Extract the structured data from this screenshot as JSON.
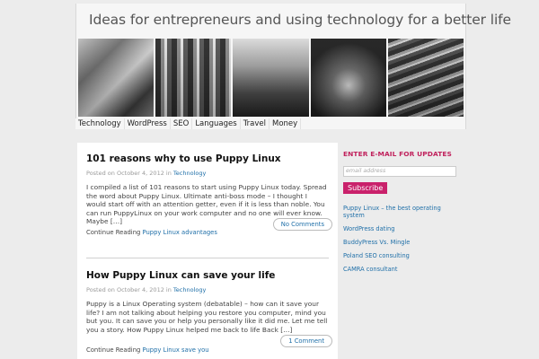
{
  "site": {
    "title": "Ideas for entrepreneurs and using technology for a better life"
  },
  "nav": [
    "Technology",
    "WordPress",
    "SEO",
    "Languages",
    "Travel",
    "Money"
  ],
  "posts": [
    {
      "title": "101 reasons why to use Puppy Linux",
      "meta_prefix": "Posted on October 4, 2012 in",
      "category": "Technology",
      "excerpt": "I compiled a list of 101 reasons to start using Puppy Linux today. Spread the word about Puppy Linux. Ultimate anti-boss mode – I thought I would start off with an attention getter, even if it is less than noble. You can run PuppyLinux on your work computer and no one will ever know. Maybe […]",
      "comments": "No Comments",
      "continue_prefix": "Continue Reading",
      "continue_link": "Puppy Linux advantages"
    },
    {
      "title": "How Puppy Linux can save your life",
      "meta_prefix": "Posted on October 4, 2012 in",
      "category": "Technology",
      "excerpt": "Puppy is a Linux Operating system (debatable) – how can it save your life?  I am not talking about helping you restore you computer, mind you but you. It can save you or help you personally like it did me. Let me tell you a story. How Puppy Linux helped me back to life Back […]",
      "comments": "1 Comment",
      "continue_prefix": "Continue Reading",
      "continue_link": "Puppy Linux save you"
    }
  ],
  "sidebar": {
    "heading": "ENTER E-MAIL FOR UPDATES",
    "email_placeholder": "email address",
    "subscribe_label": "Subscribe",
    "links": [
      "Puppy Linux – the best operating system",
      "WordPress dating",
      "BuddyPress Vs. Mingle",
      "Poland SEO consulting",
      "CAMRA consultant"
    ]
  },
  "colors": {
    "accent": "#c9216b",
    "link": "#1f6fa8",
    "background": "#ececec"
  }
}
